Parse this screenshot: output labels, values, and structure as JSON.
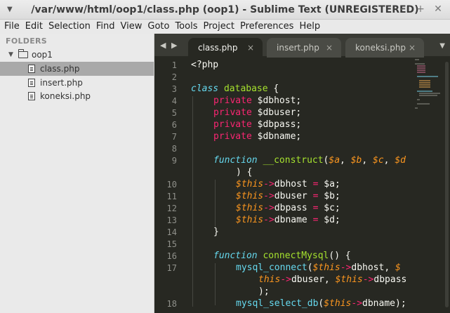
{
  "window": {
    "title": "/var/www/html/oop1/class.php (oop1) - Sublime Text (UNREGISTERED)",
    "minimize_glyph": "–",
    "maximize_glyph": "+",
    "close_glyph": "✕"
  },
  "menu": [
    "File",
    "Edit",
    "Selection",
    "Find",
    "View",
    "Goto",
    "Tools",
    "Project",
    "Preferences",
    "Help"
  ],
  "sidebar": {
    "header": "FOLDERS",
    "folder": "oop1",
    "files": [
      "class.php",
      "insert.php",
      "koneksi.php"
    ],
    "selected_file": "class.php"
  },
  "tabs": [
    {
      "label": "class.php",
      "active": true
    },
    {
      "label": "insert.php",
      "active": false
    },
    {
      "label": "koneksi.php",
      "active": false
    }
  ],
  "tab_close_glyph": "×",
  "editor": {
    "line_numbers": [
      "1",
      "2",
      "3",
      "4",
      "5",
      "6",
      "7",
      "8",
      "9",
      "",
      "10",
      "11",
      "12",
      "13",
      "14",
      "15",
      "16",
      "17",
      "",
      "",
      "18"
    ],
    "lines": [
      {
        "text": "<?php"
      },
      {
        "text": ""
      },
      {
        "text": "class database {"
      },
      {
        "text": "private $dbhost;"
      },
      {
        "text": "private $dbuser;"
      },
      {
        "text": "private $dbpass;"
      },
      {
        "text": "private $dbname;"
      },
      {
        "text": ""
      },
      {
        "text": "function __construct($a, $b, $c, $d"
      },
      {
        "text": ") {"
      },
      {
        "text": "$this->dbhost = $a;"
      },
      {
        "text": "$this->dbuser = $b;"
      },
      {
        "text": "$this->dbpass = $c;"
      },
      {
        "text": "$this->dbname = $d;"
      },
      {
        "text": "}"
      },
      {
        "text": ""
      },
      {
        "text": "function connectMysql() {"
      },
      {
        "text": "mysql_connect($this->dbhost, $"
      },
      {
        "text": "this->dbuser, $this->dbpass"
      },
      {
        "text": ");"
      },
      {
        "text": "mysql_select_db($this->dbname);"
      }
    ]
  },
  "colors": {
    "editor_bg": "#272822",
    "keyword_blue": "#66d9ef",
    "keyword_pink": "#f92672",
    "function_green": "#a6e22e",
    "param_orange": "#fd971f",
    "text": "#f8f8f2",
    "line_number": "#8f908a"
  }
}
